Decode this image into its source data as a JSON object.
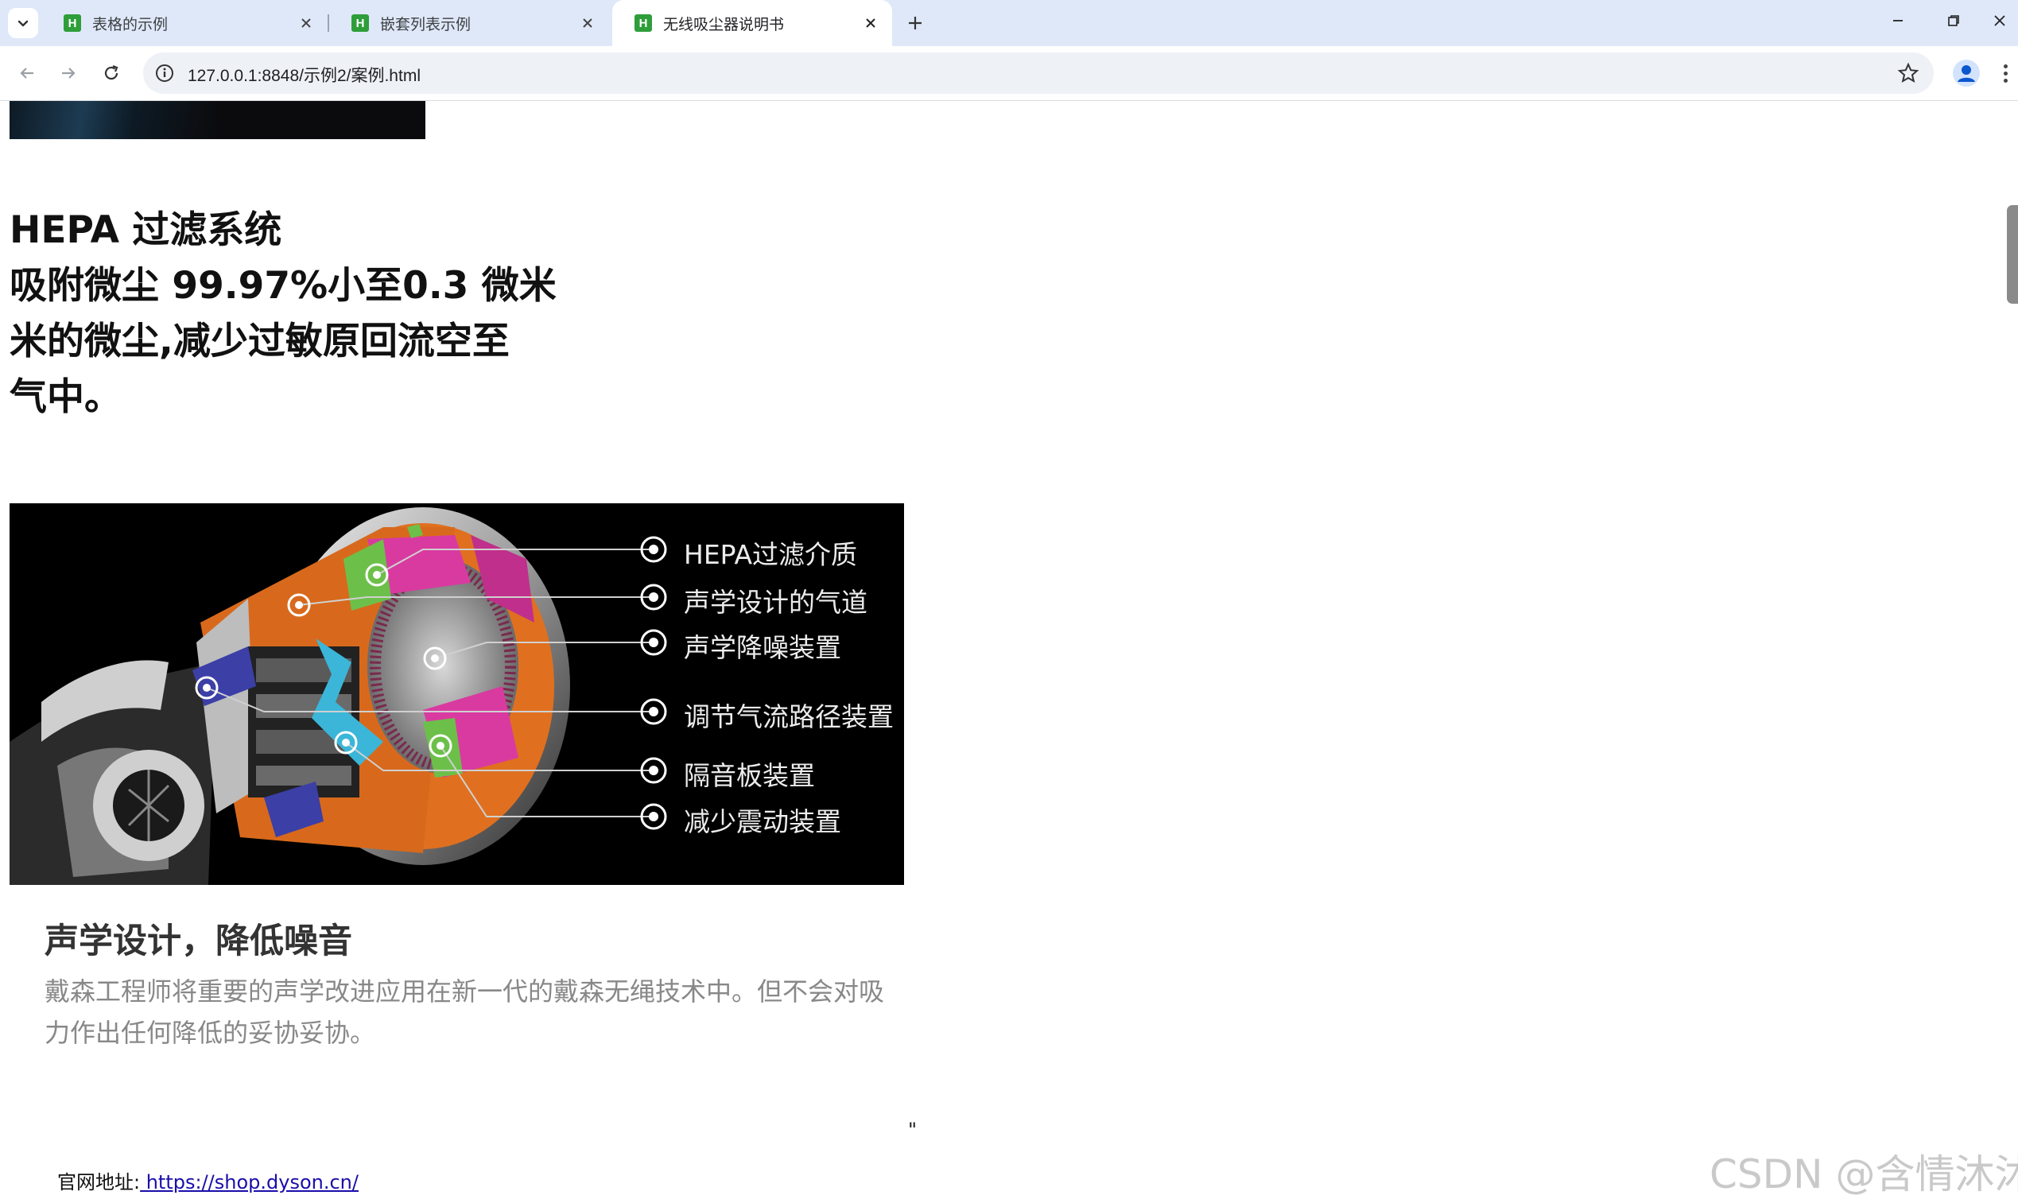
{
  "browser": {
    "tabs": [
      {
        "title": "表格的示例",
        "active": false
      },
      {
        "title": "嵌套列表示例",
        "active": false
      },
      {
        "title": "无线吸尘器说明书",
        "active": true
      }
    ],
    "url": "127.0.0.1:8848/示例2/案例.html"
  },
  "page": {
    "heading_lines": [
      "HEPA 过滤系统",
      "吸附微尘 99.97%小至0.3 微米",
      "米的微尘,减少过敏原回流空至",
      "气中。"
    ],
    "diagram_labels": [
      "HEPA过滤介质",
      "声学设计的气道",
      "声学降噪装置",
      "调节气流路径装置",
      "隔音板装置",
      "减少震动装置"
    ],
    "feature_title": "声学设计，降低噪音",
    "feature_desc": "戴森工程师将重要的声学改进应用在新一代的戴森无绳技术中。但不会对吸力作出任何降低的妥协妥协。",
    "stray_quote": "\"",
    "site_label": "官网地址:",
    "site_link": " https://shop.dyson.cn/"
  },
  "watermark": "CSDN @含情沐沐",
  "colors": {
    "tabstrip": "#dfe8f8",
    "favicon": "#2e9e3a",
    "magenta": "#d93aa0",
    "orange": "#e8731d",
    "cyan": "#3bb6d8",
    "green": "#6cc04a",
    "blue": "#3b3fa6"
  }
}
